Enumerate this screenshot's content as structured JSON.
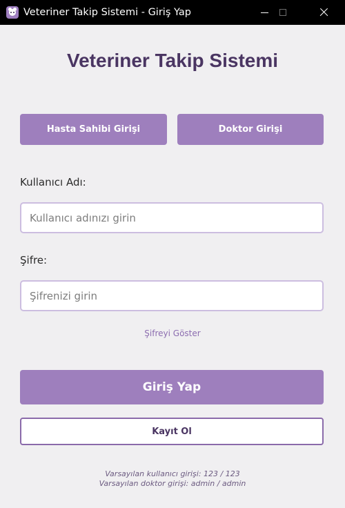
{
  "window": {
    "title": "Veteriner Takip Sistemi - Giriş Yap",
    "app_icon": "paw-icon"
  },
  "header": {
    "title": "Veteriner Takip Sistemi"
  },
  "role_tabs": {
    "owner_label": "Hasta Sahibi Girişi",
    "doctor_label": "Doktor Girişi"
  },
  "form": {
    "username_label": "Kullanıcı Adı:",
    "username_placeholder": "Kullanıcı adınızı girin",
    "username_value": "",
    "password_label": "Şifre:",
    "password_placeholder": "Şifrenizi girin",
    "password_value": "",
    "show_password_label": "Şifreyi Göster"
  },
  "actions": {
    "login_label": "Giriş Yap",
    "register_label": "Kayıt Ol"
  },
  "hints": {
    "user_default": "Varsayılan kullanıcı girişi: 123 / 123",
    "doctor_default": "Varsayılan doktor girişi: admin / admin"
  },
  "colors": {
    "accent": "#9e7fbd",
    "title": "#4a3562",
    "background": "#f0eff1",
    "input_border": "#ccbde0"
  }
}
